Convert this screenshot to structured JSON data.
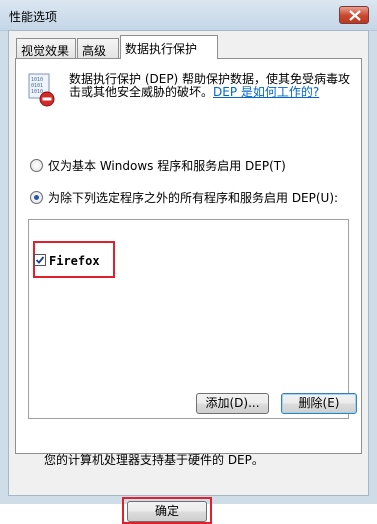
{
  "window": {
    "title": "性能选项"
  },
  "tabs": [
    {
      "label": "视觉效果",
      "selected": false
    },
    {
      "label": "高级",
      "selected": false
    },
    {
      "label": "数据执行保护",
      "selected": true
    }
  ],
  "info": {
    "text": "数据执行保护 (DEP) 帮助保护数据，使其免受病毒攻击或其他安全威胁的破坏。",
    "link": "DEP 是如何工作的?"
  },
  "options": {
    "basic_label": "仅为基本 Windows 程序和服务启用 DEP(T)",
    "all_label": "为除下列选定程序之外的所有程序和服务启用 DEP(U):",
    "selected": "all"
  },
  "program_list": {
    "items": [
      {
        "label": "Firefox",
        "checked": true
      }
    ]
  },
  "buttons": {
    "add": "添加(D)...",
    "remove": "删除(E)",
    "ok": "确定"
  },
  "hardware_note": "您的计算机处理器支持基于硬件的 DEP。",
  "colors": {
    "highlight": "#e0202b",
    "link": "#0066cc",
    "close": "#c9462c"
  }
}
